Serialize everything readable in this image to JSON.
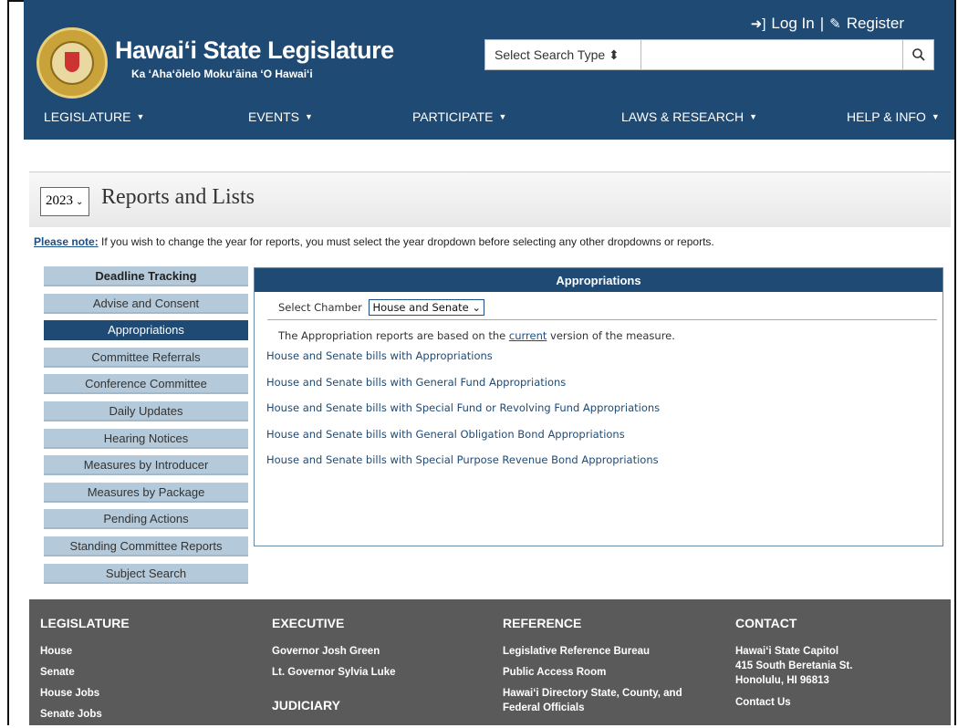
{
  "header": {
    "title": "Hawaiʻi State Legislature",
    "subtitle": "Ka ʻAhaʻōlelo Mokuʻāina ʻO Hawaiʻi",
    "login": "Log In",
    "separator": "|",
    "register": "Register",
    "search_type_placeholder": "Select Search Type ⬍",
    "search_placeholder": ""
  },
  "nav": [
    {
      "label": "LEGISLATURE"
    },
    {
      "label": "EVENTS"
    },
    {
      "label": "PARTICIPATE"
    },
    {
      "label": "LAWS & RESEARCH"
    },
    {
      "label": "HELP & INFO"
    }
  ],
  "page": {
    "year": "2023",
    "title": "Reports and Lists",
    "note_label": "Please note:",
    "note_text": " If you wish to change the year for reports, you must select the year dropdown before selecting any other dropdowns or reports."
  },
  "sidebar": {
    "items": [
      {
        "label": "Deadline Tracking"
      },
      {
        "label": "Advise and Consent"
      },
      {
        "label": "Appropriations"
      },
      {
        "label": "Committee Referrals"
      },
      {
        "label": "Conference Committee"
      },
      {
        "label": "Daily Updates"
      },
      {
        "label": "Hearing Notices"
      },
      {
        "label": "Measures by Introducer"
      },
      {
        "label": "Measures by Package"
      },
      {
        "label": "Pending Actions"
      },
      {
        "label": "Standing Committee Reports"
      },
      {
        "label": "Subject Search"
      }
    ]
  },
  "panel": {
    "title": "Appropriations",
    "chamber_label": "Select Chamber",
    "chamber_value": "House and Senate",
    "desc_pre": "The Appropriation reports are based on the ",
    "desc_link": "current",
    "desc_post": " version of the measure.",
    "links": [
      "House and Senate bills with Appropriations",
      "House and Senate bills with General Fund Appropriations",
      "House and Senate bills with Special Fund or Revolving Fund Appropriations",
      "House and Senate bills with General Obligation Bond Appropriations",
      "House and Senate bills with Special Purpose Revenue Bond Appropriations"
    ]
  },
  "footer": {
    "legislature": {
      "heading": "LEGISLATURE",
      "links": [
        "House",
        "Senate",
        "House Jobs",
        "Senate Jobs"
      ]
    },
    "executive": {
      "heading": "EXECUTIVE",
      "links": [
        "Governor Josh Green",
        "Lt. Governor Sylvia Luke"
      ],
      "heading2": "JUDICIARY"
    },
    "reference": {
      "heading": "REFERENCE",
      "links": [
        "Legislative Reference Bureau",
        "Public Access Room",
        "Hawaiʻi Directory State, County, and Federal Officials"
      ]
    },
    "contact": {
      "heading": "CONTACT",
      "address1": "Hawaiʻi State Capitol",
      "address2": "415 South Beretania St.",
      "address3": "Honolulu, HI 96813",
      "link": "Contact Us"
    }
  },
  "colors": {
    "brand": "#1f4a73",
    "sidebar": "#b4cadb",
    "footer": "#5a5a5a"
  }
}
